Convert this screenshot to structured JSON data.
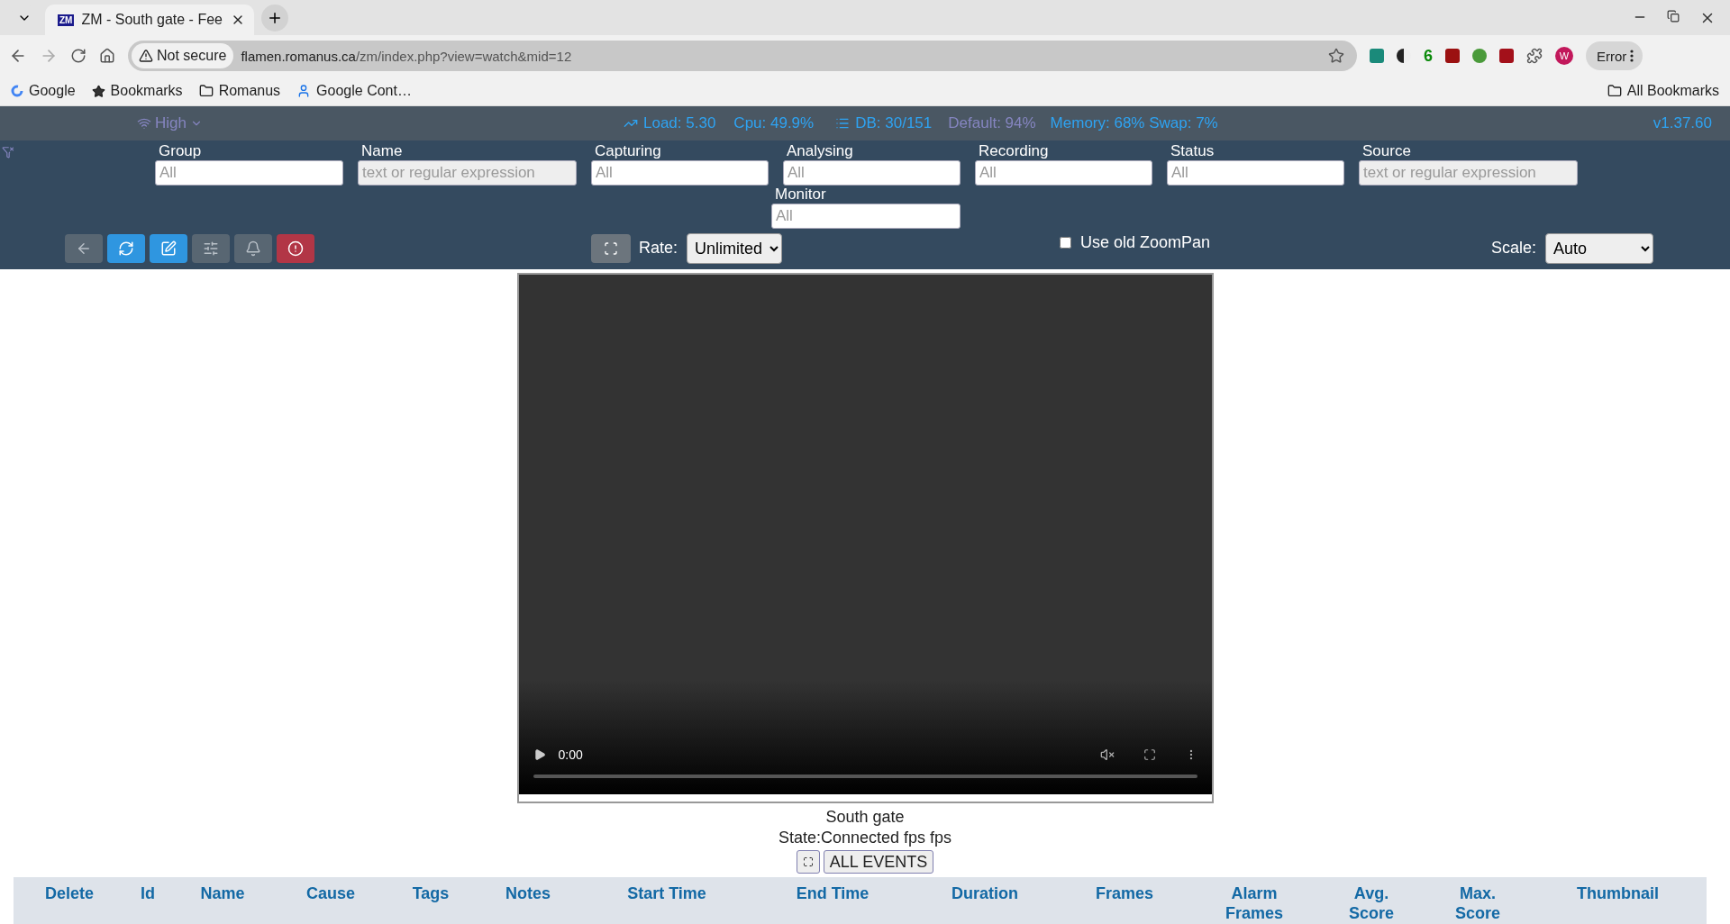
{
  "browser": {
    "tabs": [
      {
        "favicon": "ZM",
        "title": "ZM - South gate - Fee",
        "selected": true
      }
    ],
    "address": {
      "security": "Not secure",
      "host": "flamen.romanus.ca",
      "path": "/zm/index.php?view=watch&mid=12"
    },
    "extension_badge": "6",
    "profile": "W",
    "profile_status": "Error",
    "bookmarks": [
      {
        "kind": "google",
        "label": "Google"
      },
      {
        "kind": "star",
        "label": "Bookmarks"
      },
      {
        "kind": "folder",
        "label": "Romanus"
      },
      {
        "kind": "contacts",
        "label": "Google Cont…"
      }
    ],
    "all_bookmarks": "All Bookmarks"
  },
  "status": {
    "bandwidth": "High",
    "load": "Load: 5.30",
    "cpu": "Cpu: 49.9%",
    "db": "DB: 30/151",
    "disk": "Default: 94%",
    "memory": "Memory: 68% Swap: 7%",
    "version": "v1.37.60"
  },
  "filters": [
    {
      "label": "Group",
      "kind": "select",
      "placeholder": "All"
    },
    {
      "label": "Name",
      "kind": "text",
      "placeholder": "text or regular expression"
    },
    {
      "label": "Capturing",
      "kind": "select",
      "placeholder": "All"
    },
    {
      "label": "Analysing",
      "kind": "select",
      "placeholder": "All"
    },
    {
      "label": "Recording",
      "kind": "select",
      "placeholder": "All"
    },
    {
      "label": "Status",
      "kind": "select",
      "placeholder": "All"
    },
    {
      "label": "Source",
      "kind": "text",
      "placeholder": "text or regular expression"
    },
    {
      "label": "Monitor",
      "kind": "select",
      "placeholder": "All"
    }
  ],
  "actions": [
    {
      "kind": "back"
    },
    {
      "kind": "refresh"
    },
    {
      "kind": "edit"
    },
    {
      "kind": "settings"
    },
    {
      "kind": "alarm"
    },
    {
      "kind": "alert"
    }
  ],
  "rate": {
    "label": "Rate:",
    "value": "Unlimited"
  },
  "zoompan": {
    "label": "Use old ZoomPan",
    "checked": false
  },
  "scale": {
    "label": "Scale:",
    "value": "Auto"
  },
  "video": {
    "time": "0:00",
    "muted": true
  },
  "monitor_name": "South gate",
  "monitor_state": "State:Connected fps fps",
  "all_events": "ALL EVENTS",
  "events_table": {
    "columns": [
      "Delete",
      "Id",
      "Name",
      "Cause",
      "Tags",
      "Notes",
      "Start Time",
      "End Time",
      "Duration",
      "Frames",
      "Alarm Frames",
      "Avg. Score",
      "Max. Score",
      "Thumbnail"
    ]
  }
}
